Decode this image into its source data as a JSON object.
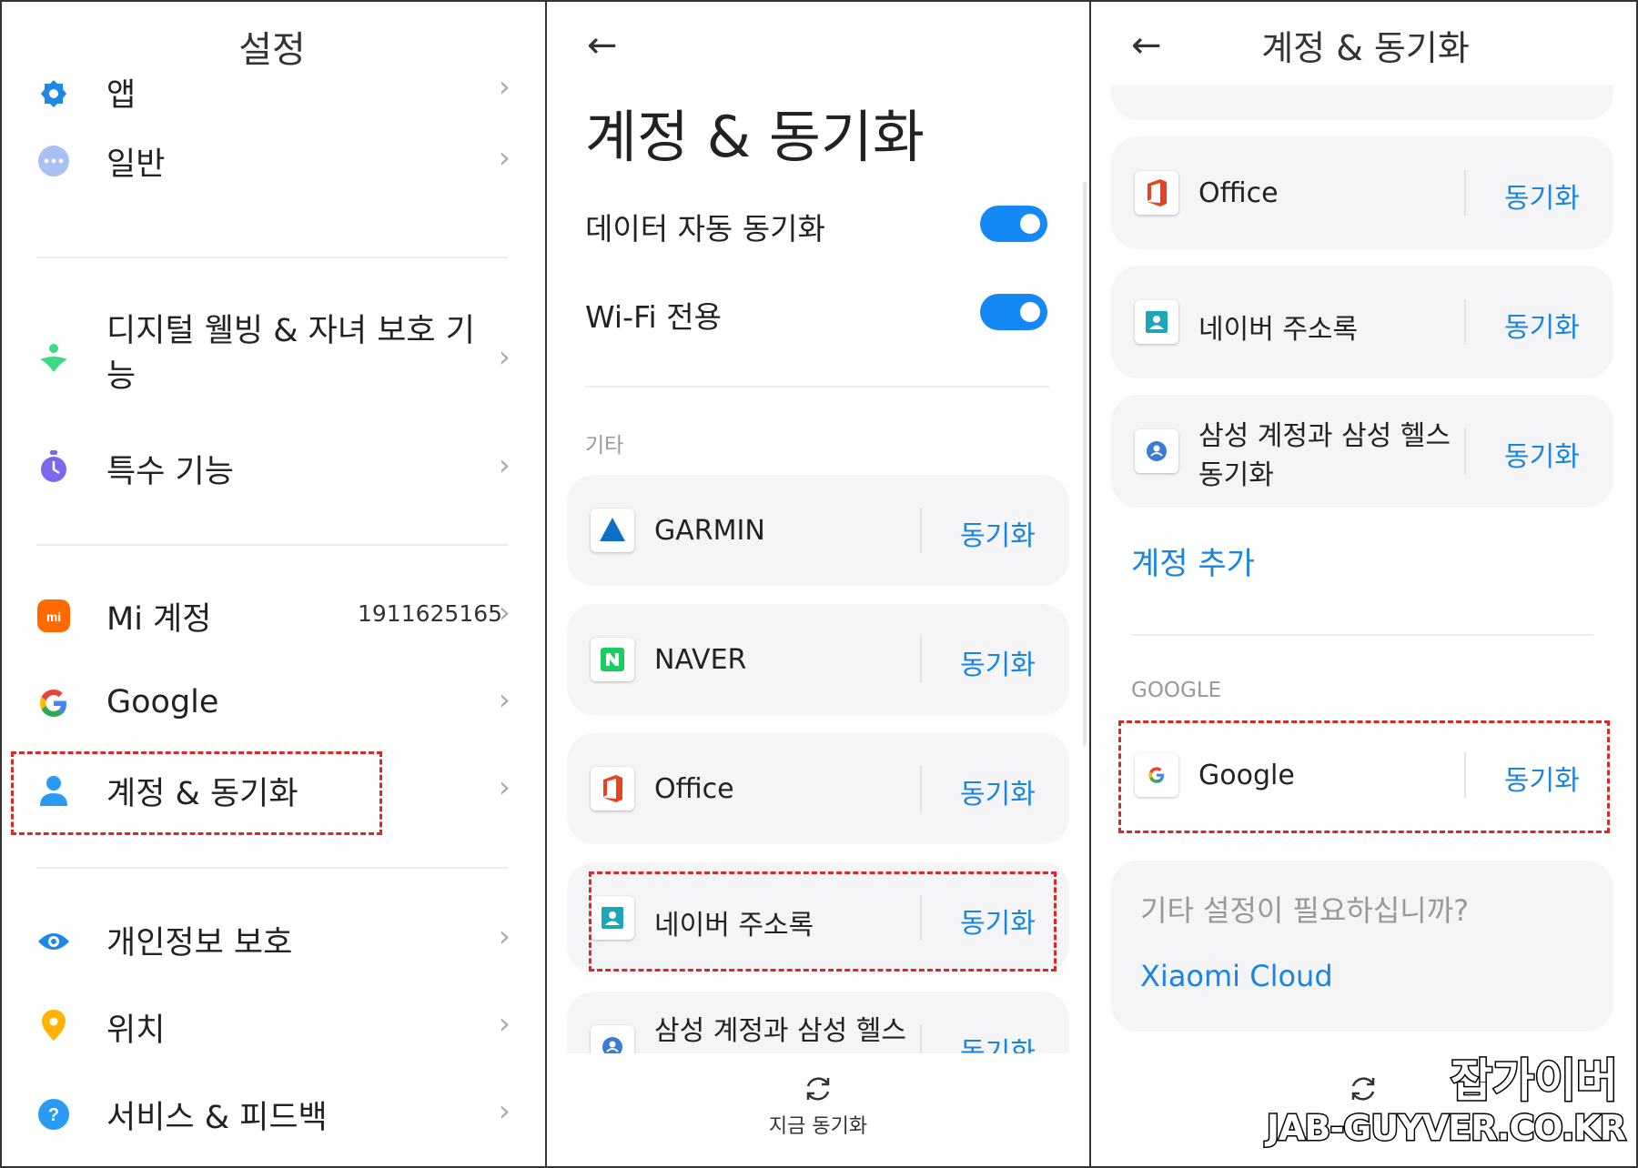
{
  "panel1": {
    "title": "설정",
    "items": [
      {
        "label": "앱",
        "icon": "gear-icon",
        "color": "#1e88e5"
      },
      {
        "label": "일반",
        "icon": "more-icon",
        "color": "#9fb7f0"
      },
      {
        "label": "디지털 웰빙 & 자녀 보호 기",
        "label2": "능",
        "icon": "wellbeing-icon",
        "color": "#3ddc84"
      },
      {
        "label": "특수 기능",
        "icon": "accessibility-icon",
        "color": "#7b68ee"
      },
      {
        "label": "Mi 계정",
        "value": "1911625165",
        "icon": "mi-icon",
        "color": "#ff6900"
      },
      {
        "label": "Google",
        "icon": "google-icon"
      },
      {
        "label": "계정 & 동기화",
        "icon": "account-icon",
        "color": "#2b9af3"
      },
      {
        "label": "개인정보 보호",
        "icon": "eye-icon",
        "color": "#1e88e5"
      },
      {
        "label": "위치",
        "icon": "location-icon",
        "color": "#ffb300"
      },
      {
        "label": "서비스 & 피드백",
        "icon": "help-icon",
        "color": "#2b9af3"
      }
    ]
  },
  "panel2": {
    "back": "←",
    "title": "계정 & 동기화",
    "toggles": [
      {
        "label": "데이터 자동 동기화",
        "on": true
      },
      {
        "label": "Wi-Fi 전용",
        "on": true
      }
    ],
    "section": "기타",
    "accounts": [
      {
        "name": "GARMIN",
        "sync": "동기화",
        "icon": "garmin-icon"
      },
      {
        "name": "NAVER",
        "sync": "동기화",
        "icon": "naver-icon"
      },
      {
        "name": "Office",
        "sync": "동기화",
        "icon": "office-icon"
      },
      {
        "name": "네이버 주소록",
        "sync": "동기화",
        "icon": "contacts-icon"
      },
      {
        "name": "삼성 계정과 삼성 헬스",
        "sync": "동기화",
        "icon": "samsung-icon"
      }
    ],
    "sync_now": "지금 동기화"
  },
  "panel3": {
    "back": "←",
    "title": "계정 & 동기화",
    "accounts": [
      {
        "name": "Office",
        "sync": "동기화",
        "icon": "office-icon"
      },
      {
        "name": "네이버 주소록",
        "sync": "동기화",
        "icon": "contacts-icon"
      },
      {
        "name": "삼성 계정과 삼성 헬스",
        "name2": "동기화",
        "sync": "동기화",
        "icon": "samsung-icon"
      }
    ],
    "add_account": "계정 추가",
    "google_section": "GOOGLE",
    "google_account": {
      "name": "Google",
      "sync": "동기화"
    },
    "other_settings_question": "기타 설정이 필요하십니까?",
    "xiaomi_cloud": "Xiaomi Cloud"
  },
  "watermark": {
    "line1": "잡가이버",
    "line2": "JAB-GUYVER.CO.KR"
  },
  "colors": {
    "accent": "#1a84e0",
    "toggle": "#1489f5",
    "highlight": "#d42a2a"
  }
}
